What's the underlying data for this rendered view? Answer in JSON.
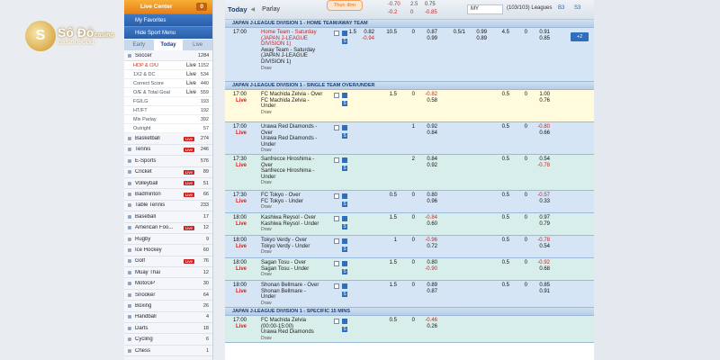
{
  "left": {
    "live_center": "Live Center",
    "live_count": "0",
    "my_favorites": "My Favorites",
    "hide_menu": "Hide Sport Menu",
    "tabs": [
      "Early",
      "Today",
      "Live"
    ],
    "soccer": {
      "name": "Soccer",
      "count": "1284"
    },
    "sub": [
      {
        "name": "HDP & O/U",
        "count": "1152",
        "live": true,
        "selected": true
      },
      {
        "name": "1X2 & DC",
        "count": "534",
        "live": true
      },
      {
        "name": "Correct Score",
        "count": "440",
        "live": true
      },
      {
        "name": "O/E & Total Goal",
        "count": "559",
        "live": true
      },
      {
        "name": "FG/LG",
        "count": "193",
        "live": false
      },
      {
        "name": "HT/FT",
        "count": "192",
        "live": false
      },
      {
        "name": "Mix Parlay",
        "count": "392",
        "live": false
      },
      {
        "name": "Outright",
        "count": "57",
        "live": false
      }
    ],
    "sports": [
      {
        "name": "Basketball",
        "count": "274",
        "live": true
      },
      {
        "name": "Tennis",
        "count": "246",
        "live": true
      },
      {
        "name": "E-Sports",
        "count": "576",
        "live": false
      },
      {
        "name": "Cricket",
        "count": "89",
        "live": true
      },
      {
        "name": "Volleyball",
        "count": "51",
        "live": true
      },
      {
        "name": "Badminton",
        "count": "66",
        "live": true
      },
      {
        "name": "Table Tennis",
        "count": "233",
        "live": false
      },
      {
        "name": "Baseball",
        "count": "17",
        "live": false
      },
      {
        "name": "American Foo...",
        "count": "12",
        "live": true
      },
      {
        "name": "Rugby",
        "count": "9",
        "live": false
      },
      {
        "name": "Ice Hockey",
        "count": "60",
        "live": false
      },
      {
        "name": "Golf",
        "count": "76",
        "live": true
      },
      {
        "name": "Muay Thai",
        "count": "12",
        "live": false
      },
      {
        "name": "MotoGP",
        "count": "30",
        "live": false
      },
      {
        "name": "Snooker",
        "count": "64",
        "live": false
      },
      {
        "name": "Boxing",
        "count": "26",
        "live": false
      },
      {
        "name": "Handball",
        "count": "4",
        "live": false
      },
      {
        "name": "Darts",
        "count": "18",
        "live": false
      },
      {
        "name": "Cycling",
        "count": "6",
        "live": false
      },
      {
        "name": "Chess",
        "count": "1",
        "live": false
      }
    ]
  },
  "logo": {
    "text": "Số Đỏ",
    "small": "casino",
    "sub": "casinosodo"
  },
  "topbar": {
    "today": "Today",
    "parlay": "Parlay",
    "odds_btn": "Thực đơn",
    "c1": "-0.70",
    "c2": "2.5",
    "c3": "0.75",
    "c4": "-0.2",
    "c5": "0",
    "c6": "-0.85",
    "select": "MY",
    "leagues": "(103/103) Leagues",
    "icon1": "B3",
    "icon2": "S3"
  },
  "leagues": [
    "JAPAN J-LEAGUE DIVISION 1 - HOME TEAM/AWAY TEAM",
    "JAPAN J-LEAGUE DIVISION 1 - SINGLE TEAM OVER/UNDER",
    "JAPAN J-LEAGUE DIVISION 1 - SPECIFIC 15 MINS"
  ],
  "more_btn": "+2",
  "draw": "Draw",
  "live": "Live",
  "matches": [
    {
      "time": "17:00",
      "live": false,
      "teams": [
        "Home Team - Saturday",
        "(JAPAN J-LEAGUE",
        "DIVISION 1)",
        "Away Team - Saturday",
        "(JAPAN J-LEAGUE",
        "DIVISION 1)"
      ],
      "odds": [
        "1.5",
        "0.82",
        "10.5",
        "0",
        "0.87",
        "0.5/1",
        "0.99",
        "4.5",
        "0",
        "0.91",
        "-0.94",
        "0.99",
        "0.89",
        "0.85"
      ]
    },
    {
      "time": "17:00",
      "live": true,
      "teams": [
        "FC Machida Zelvia - Over",
        "FC Machida Zelvia -",
        "Under"
      ],
      "odds": [
        "1.5",
        "0",
        "-0.82",
        "0.58",
        "0.5",
        "0",
        "1.00",
        "0.76"
      ]
    },
    {
      "time": "17:00",
      "live": true,
      "teams": [
        "Urawa Red Diamonds -",
        "Over",
        "Urawa Red Diamonds -",
        "Under"
      ],
      "odds": [
        "1",
        "0.92",
        "0.84",
        "0.5",
        "0",
        "-0.80",
        "0.66"
      ]
    },
    {
      "time": "17:30",
      "live": true,
      "teams": [
        "Sanfrecce Hiroshima -",
        "Over",
        "Sanfrecce Hiroshima -",
        "Under"
      ],
      "odds": [
        "2",
        "0.84",
        "0.92",
        "0.5",
        "0",
        "0.54",
        "-0.78"
      ]
    },
    {
      "time": "17:30",
      "live": true,
      "teams": [
        "FC Tokyo - Over",
        "FC Tokyo - Under"
      ],
      "odds": [
        "0.5",
        "0",
        "0.80",
        "0.96",
        "0.5",
        "0",
        "-0.57",
        "0.33"
      ]
    },
    {
      "time": "18:00",
      "live": true,
      "teams": [
        "Kashiwa Reysol - Over",
        "Kashiwa Reysol - Under"
      ],
      "odds": [
        "1.5",
        "0",
        "-0.84",
        "0.60",
        "0.5",
        "0",
        "0.97",
        "0.79"
      ]
    },
    {
      "time": "18:00",
      "live": true,
      "teams": [
        "Tokyo Verdy - Over",
        "Tokyo Verdy - Under"
      ],
      "odds": [
        "1",
        "0",
        "-0.96",
        "0.72",
        "0.5",
        "0",
        "-0.78",
        "0.54"
      ]
    },
    {
      "time": "18:00",
      "live": true,
      "teams": [
        "Sagan Tosu - Over",
        "Sagan Tosu - Under"
      ],
      "odds": [
        "1.5",
        "0",
        "0.80",
        "-0.90",
        "0.5",
        "0",
        "-0.92",
        "0.68"
      ]
    },
    {
      "time": "18:00",
      "live": true,
      "teams": [
        "Shonan Bellmare - Over",
        "Shonan Bellmare -",
        "Under"
      ],
      "odds": [
        "1.5",
        "0",
        "0.89",
        "0.87",
        "0.5",
        "0",
        "0.85",
        "0.91"
      ]
    },
    {
      "time": "17:00",
      "live": true,
      "teams": [
        "FC Machida Zelvia",
        "(00:00-15:00)",
        "Urawa Red Diamonds"
      ],
      "odds": [
        "0.5",
        "0",
        "-0.46",
        "0.26"
      ]
    }
  ]
}
